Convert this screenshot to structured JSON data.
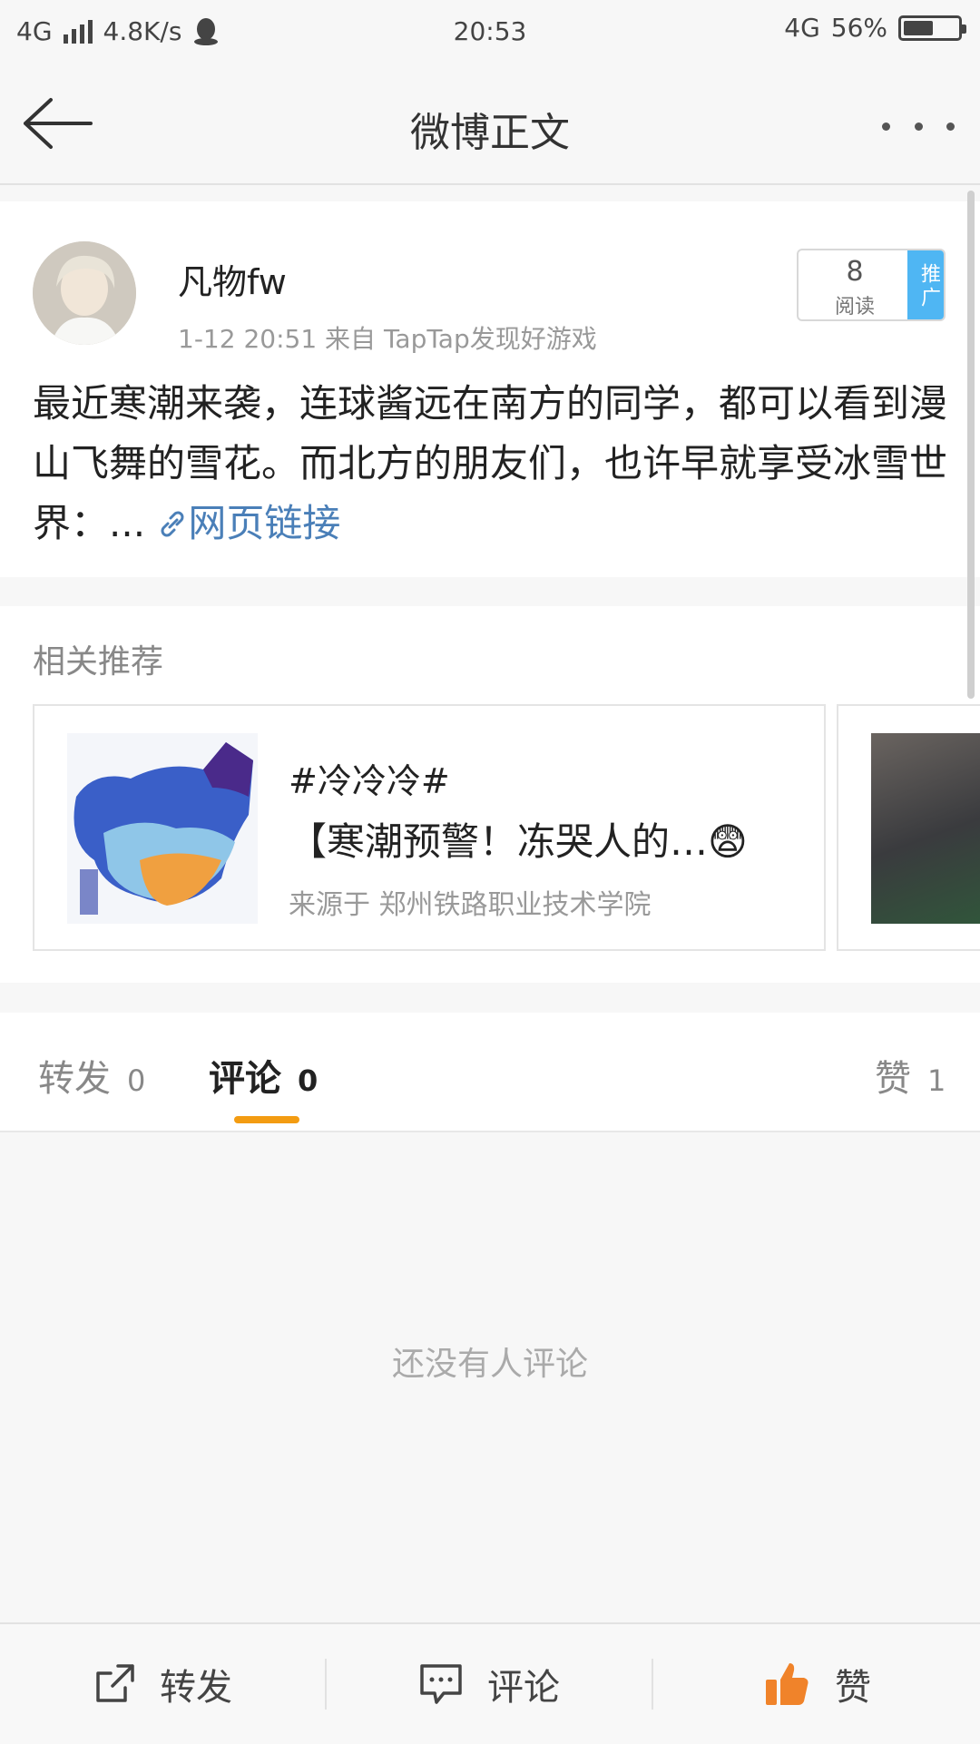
{
  "status_bar": {
    "network": "4G",
    "speed": "4.8K/s",
    "time": "20:53",
    "network_right": "4G",
    "battery": "56%",
    "battery_level": 0.56
  },
  "header": {
    "title": "微博正文"
  },
  "post": {
    "username": "凡物fw",
    "meta": "1-12 20:51  来自 TapTap发现好游戏",
    "reads_count": "8",
    "reads_label": "阅读",
    "promote_label": "推广",
    "body": "最近寒潮来袭，连球酱远在南方的同学，都可以看到漫山飞舞的雪花。而北方的朋友们，也许早就享受冰雪世界：...",
    "link_label": "网页链接"
  },
  "recommendations": {
    "section_title": "相关推荐",
    "card": {
      "tag": "#冷冷冷#",
      "headline": "【寒潮预警！冻哭人的…😨",
      "source": "来源于 郑州铁路职业技术学院"
    }
  },
  "tabs": {
    "repost_label": "转发",
    "repost_count": "0",
    "comment_label": "评论",
    "comment_count": "0",
    "like_label": "赞",
    "like_count": "1"
  },
  "comments": {
    "empty_text": "还没有人评论"
  },
  "actions": {
    "repost_label": "转发",
    "comment_label": "评论",
    "like_label": "赞"
  },
  "colors": {
    "accent": "#f39c12",
    "link": "#4a7fb8",
    "promo": "#4fb6f3"
  }
}
